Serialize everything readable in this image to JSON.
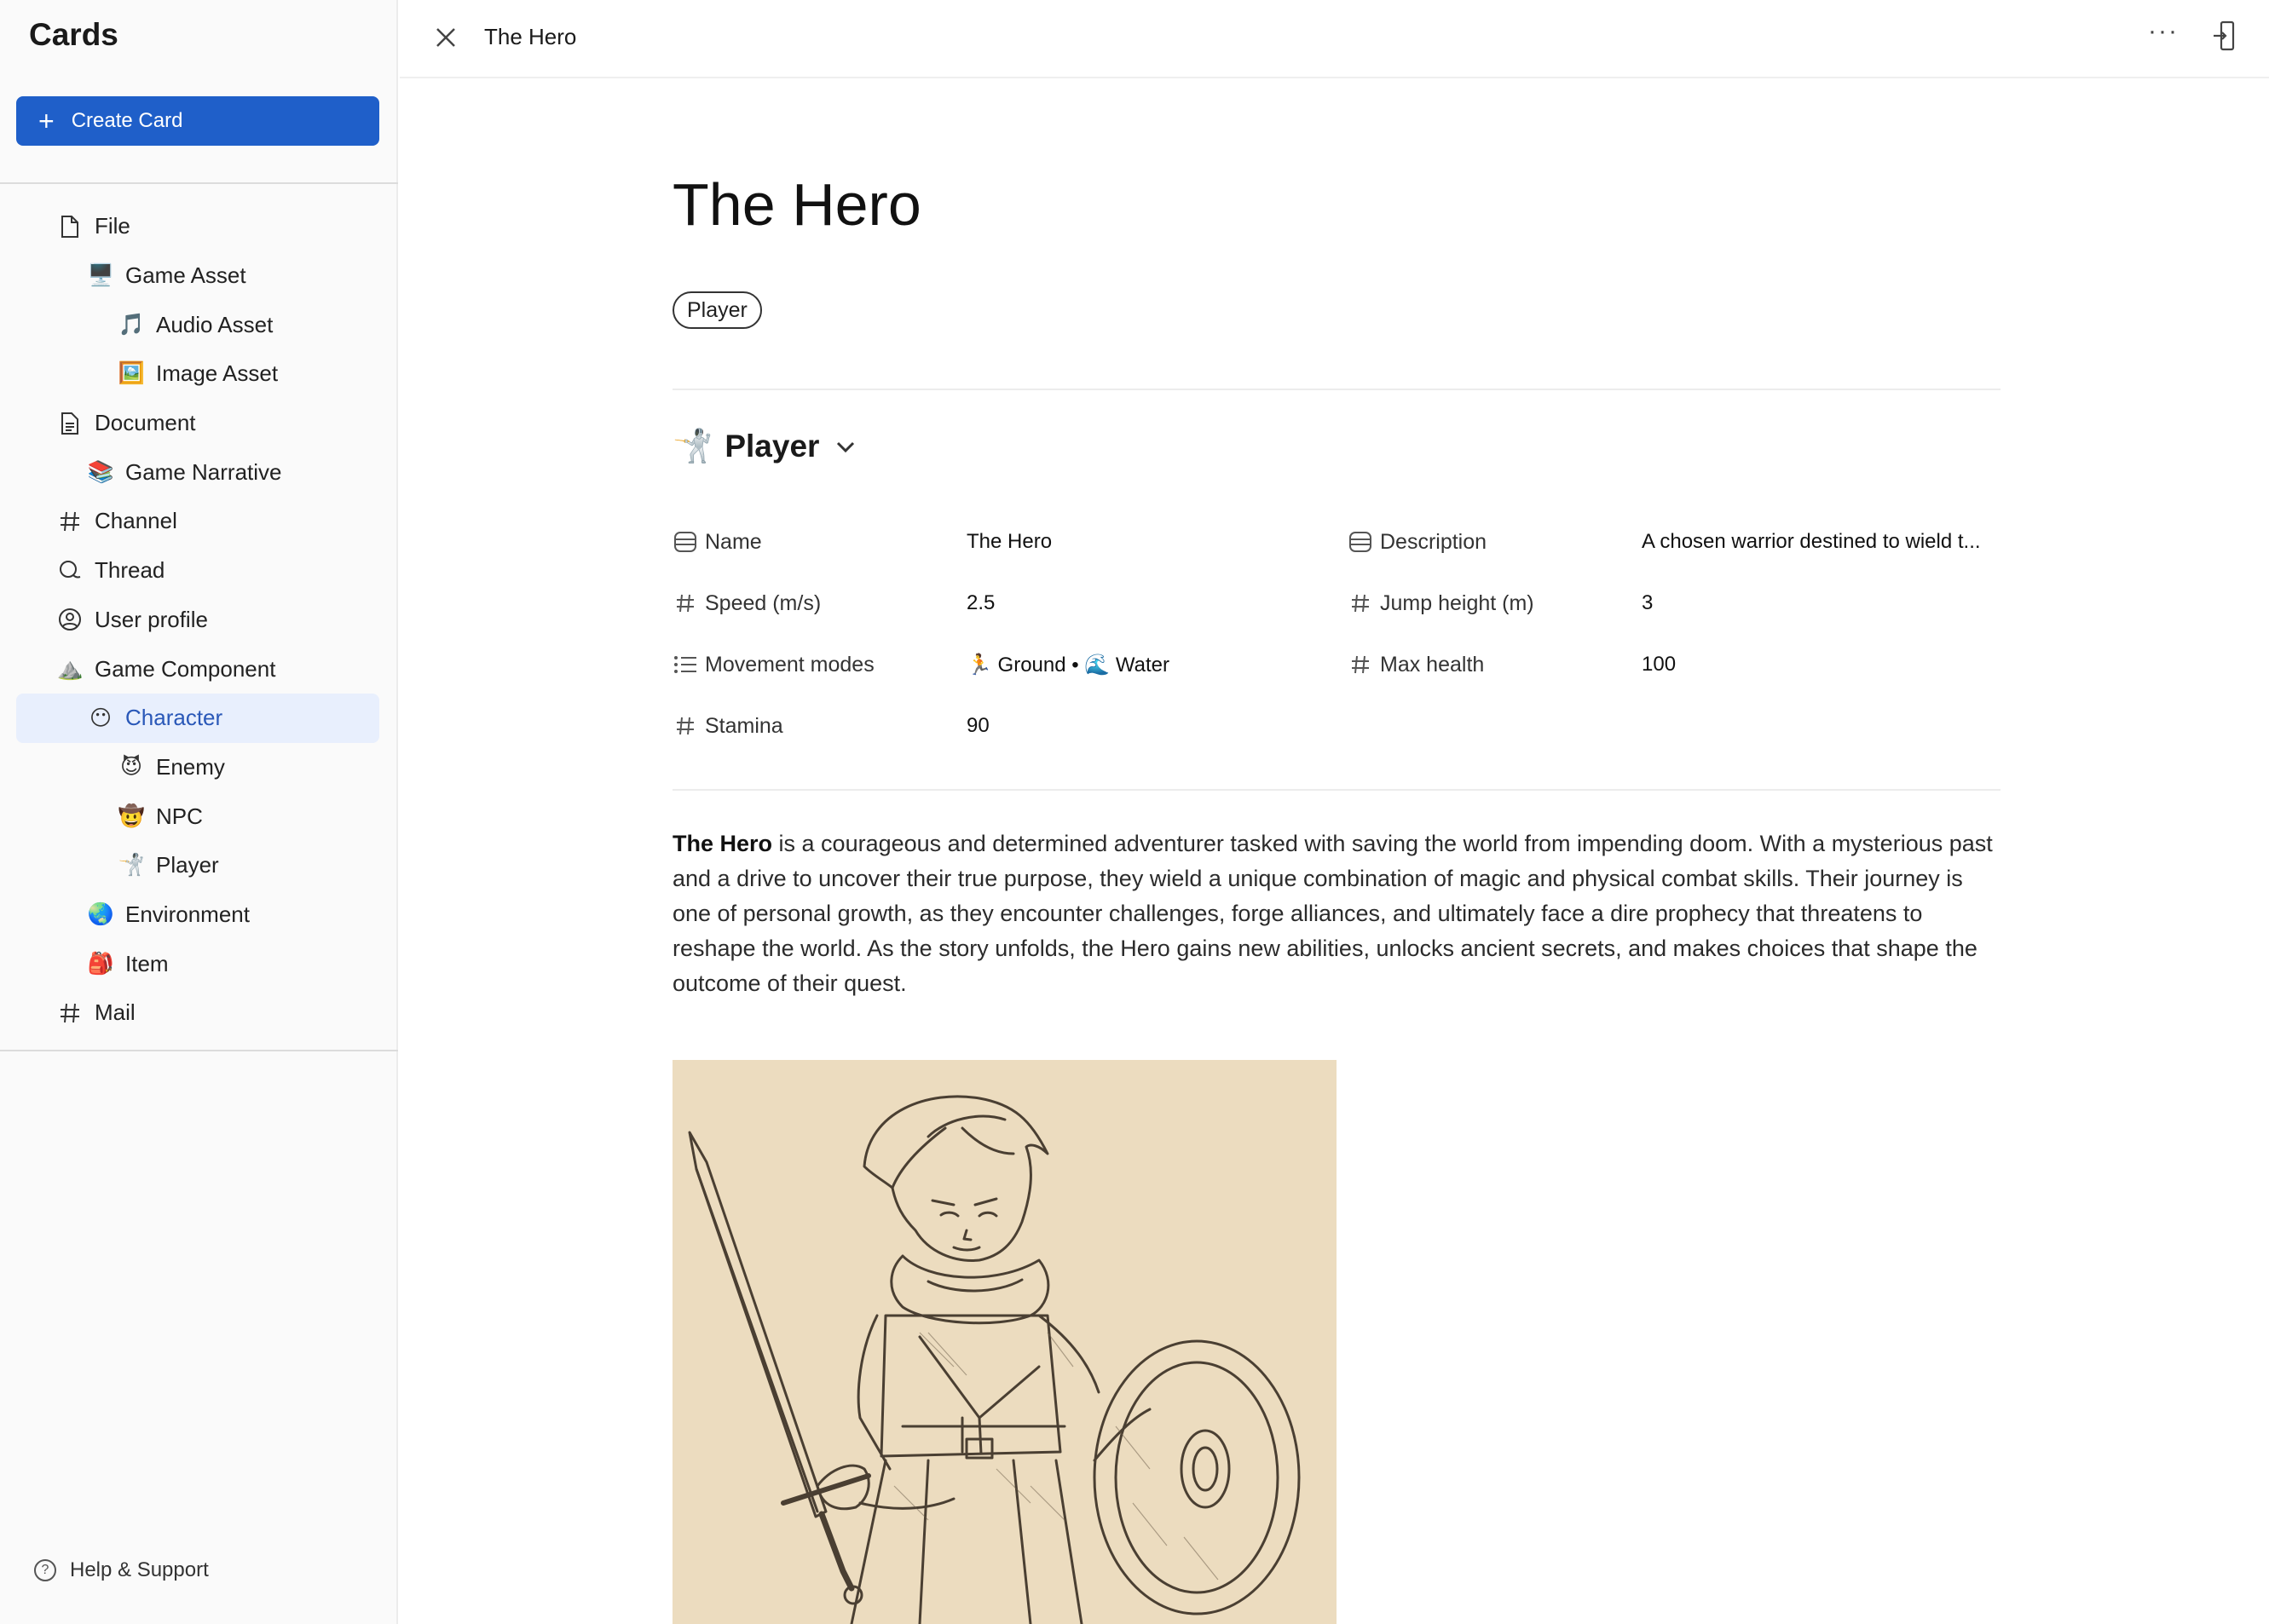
{
  "sidebar": {
    "title": "Cards",
    "create_label": "Create Card",
    "items": [
      {
        "label": "File",
        "icon": "file-icon"
      },
      {
        "label": "Game Asset",
        "icon": "monitor-icon",
        "glyph": "🖥️"
      },
      {
        "label": "Audio Asset",
        "icon": "music-note-icon",
        "glyph": "🎵"
      },
      {
        "label": "Image Asset",
        "icon": "framed-picture-icon",
        "glyph": "🖼️"
      },
      {
        "label": "Document",
        "icon": "document-icon"
      },
      {
        "label": "Game Narrative",
        "icon": "books-icon",
        "glyph": "📚"
      },
      {
        "label": "Channel",
        "icon": "hash-icon"
      },
      {
        "label": "Thread",
        "icon": "thread-icon"
      },
      {
        "label": "User profile",
        "icon": "user-circle-icon"
      },
      {
        "label": "Game Component",
        "icon": "mountain-icon",
        "glyph": "⛰️"
      },
      {
        "label": "Character",
        "icon": "face-icon",
        "glyph": "😶"
      },
      {
        "label": "Enemy",
        "icon": "devil-icon",
        "glyph": "😈"
      },
      {
        "label": "NPC",
        "icon": "cowboy-icon",
        "glyph": "🤠"
      },
      {
        "label": "Player",
        "icon": "fencer-icon",
        "glyph": "🤺"
      },
      {
        "label": "Environment",
        "icon": "globe-icon",
        "glyph": "🌏"
      },
      {
        "label": "Item",
        "icon": "backpack-icon",
        "glyph": "🎒"
      },
      {
        "label": "Mail",
        "icon": "hash-icon"
      }
    ],
    "help_label": "Help & Support"
  },
  "topbar": {
    "title": "The Hero",
    "more_label": "···"
  },
  "card": {
    "title": "The Hero",
    "tag": "Player",
    "section": {
      "emoji": "🤺",
      "title": "Player"
    },
    "props": {
      "name_label": "Name",
      "name_value": "The Hero",
      "desc_label": "Description",
      "desc_value": "A chosen warrior destined to wield t...",
      "speed_label": "Speed (m/s)",
      "speed_value": "2.5",
      "jump_label": "Jump height (m)",
      "jump_value": "3",
      "movement_label": "Movement modes",
      "movement_value": "🏃 Ground • 🌊 Water",
      "health_label": "Max health",
      "health_value": "100",
      "stamina_label": "Stamina",
      "stamina_value": "90"
    },
    "body_bold": "The Hero",
    "body_rest": " is a courageous and determined adventurer tasked with saving the world from impending doom. With a mysterious past and a drive to uncover their true purpose, they wield a unique combination of magic and physical combat skills. Their journey is one of personal growth, as they encounter challenges, forge alliances, and ultimately face a dire prophecy that threatens to reshape the world. As the story unfolds, the Hero gains new abilities, unlocks ancient secrets, and makes choices that shape the outcome of their quest."
  },
  "colors": {
    "accent": "#1f5fc9",
    "active_bg": "#e8effd",
    "active_text": "#2a58b8",
    "sketch_bg": "#ecdcbf"
  }
}
